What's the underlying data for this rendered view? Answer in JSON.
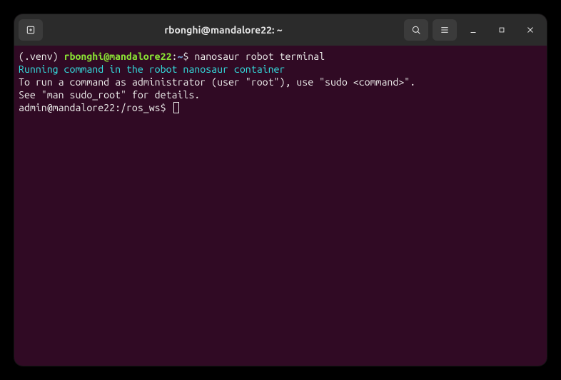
{
  "titlebar": {
    "title": "rbonghi@mandalore22: ~"
  },
  "terminal": {
    "line1": {
      "venv": "(.venv) ",
      "userhost": "rbonghi@mandalore22",
      "colon": ":",
      "path": "~",
      "prompt": "$ ",
      "command": "nanosaur robot terminal"
    },
    "line2": "Running command in the robot nanosaur container",
    "line3": "To run a command as administrator (user \"root\"), use \"sudo <command>\".",
    "line4": "See \"man sudo_root\" for details.",
    "line5": "",
    "line6": {
      "prompt": "admin@mandalore22:/ros_ws$ "
    }
  },
  "colors": {
    "terminal_bg": "#300a24",
    "titlebar_bg": "#2b2b2b",
    "text": "#eeeeec",
    "green": "#8ae234",
    "blue": "#729fcf",
    "cyan": "#34e2e2"
  }
}
